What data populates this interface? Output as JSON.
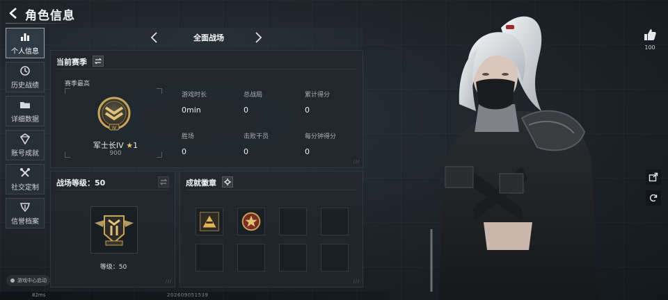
{
  "header": {
    "title": "角色信息"
  },
  "sidebar": {
    "items": [
      {
        "label": "个人信息",
        "icon": "bar-chart-icon",
        "active": true
      },
      {
        "label": "历史战绩",
        "icon": "history-icon",
        "active": false
      },
      {
        "label": "详细数据",
        "icon": "folder-icon",
        "active": false
      },
      {
        "label": "账号成就",
        "icon": "achievement-icon",
        "active": false
      },
      {
        "label": "社交定制",
        "icon": "tools-icon",
        "active": false
      },
      {
        "label": "信誉档案",
        "icon": "credit-icon",
        "active": false
      }
    ],
    "footer_label": "游戏中心启动"
  },
  "mode": {
    "current": "全面战场"
  },
  "season": {
    "title": "当前赛季",
    "best_label": "赛季最高",
    "rank_name": "军士长IV",
    "rank_stars": "1",
    "rank_score": "900",
    "stats": [
      {
        "label": "游戏时长",
        "value": "0min"
      },
      {
        "label": "总战局",
        "value": "0"
      },
      {
        "label": "累计得分",
        "value": "0"
      },
      {
        "label": "胜场",
        "value": "0"
      },
      {
        "label": "击败干员",
        "value": "0"
      },
      {
        "label": "每分钟得分",
        "value": "0"
      }
    ]
  },
  "level": {
    "title": "战场等级：50",
    "level_text": "等级：50"
  },
  "badges": {
    "title": "成就徽章"
  },
  "right": {
    "like_count": "100"
  },
  "status": {
    "ping": "82ms",
    "uid": "202609051539"
  },
  "colors": {
    "accent_gold": "#c9a45a",
    "panel_bg": "#20282e"
  }
}
